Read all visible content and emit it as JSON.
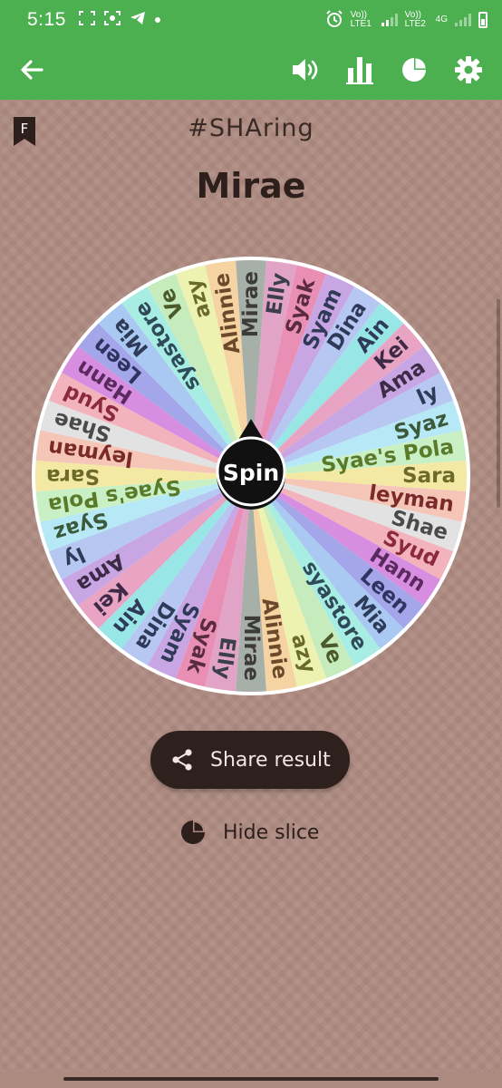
{
  "status": {
    "time": "5:15",
    "left_icons": [
      "screenshot-icon",
      "screen-record-icon",
      "telegram-icon"
    ],
    "sim1": "Vo)) LTE1",
    "sim2": "Vo)) LTE2",
    "network": "4G"
  },
  "appbar": {
    "back_icon": "arrow-back-icon",
    "actions": [
      "volume-icon",
      "bar-chart-icon",
      "pie-chart-icon",
      "gear-icon"
    ],
    "colors": {
      "bar": "#4caf50"
    }
  },
  "header": {
    "badge": "F",
    "subtitle": "#SHAring",
    "result": "Mirae"
  },
  "wheel": {
    "center_label": "Spin",
    "slices": [
      {
        "label": "Mirae",
        "color": "#a6b0a8",
        "text": "#3d3a3a"
      },
      {
        "label": "Elly",
        "color": "#e2a4c6",
        "text": "#3b3f4c"
      },
      {
        "label": "Syak",
        "color": "#e98fb6",
        "text": "#5a2a3e"
      },
      {
        "label": "Syam",
        "color": "#c7a6e3",
        "text": "#2f3a58"
      },
      {
        "label": "Dina",
        "color": "#b6c7f1",
        "text": "#2f3a58"
      },
      {
        "label": "Ain",
        "color": "#98e6e6",
        "text": "#2f3a58"
      },
      {
        "label": "Kei",
        "color": "#e8a4c2",
        "text": "#3d2a46"
      },
      {
        "label": "Ama",
        "color": "#c7a6e3",
        "text": "#3d2a46"
      },
      {
        "label": "ly",
        "color": "#b6c7f1",
        "text": "#2f3a58"
      },
      {
        "label": "Syaz",
        "color": "#b6e8f5",
        "text": "#3c5a3a"
      },
      {
        "label": "Syae's Pola",
        "color": "#c9f0c4",
        "text": "#5a7a2a"
      },
      {
        "label": "Sara",
        "color": "#f3e9a5",
        "text": "#6e6a2a"
      },
      {
        "label": "leyman",
        "color": "#f5c6b8",
        "text": "#7a2a2a"
      },
      {
        "label": "Shae",
        "color": "#e2e2e2",
        "text": "#4a4a4a"
      },
      {
        "label": "Syud",
        "color": "#f3b3bd",
        "text": "#8a2a3a"
      },
      {
        "label": "Hann",
        "color": "#d88ee0",
        "text": "#5a2a5e"
      },
      {
        "label": "Leen",
        "color": "#a3a6e8",
        "text": "#2f3360"
      },
      {
        "label": "Mia",
        "color": "#a9c9f3",
        "text": "#2f3a58"
      },
      {
        "label": "syastore",
        "color": "#a8ede3",
        "text": "#2f4a58"
      },
      {
        "label": "Ve",
        "color": "#c6ecbe",
        "text": "#4a5a2a"
      },
      {
        "label": "azy",
        "color": "#eef2b0",
        "text": "#6a6a2a"
      },
      {
        "label": "Alinnie",
        "color": "#f5d3a3",
        "text": "#6a4a2a"
      }
    ]
  },
  "share_button": {
    "label": "Share result",
    "icon": "share-icon"
  },
  "hide_slice": {
    "label": "Hide slice",
    "icon": "pie-chart-icon"
  }
}
